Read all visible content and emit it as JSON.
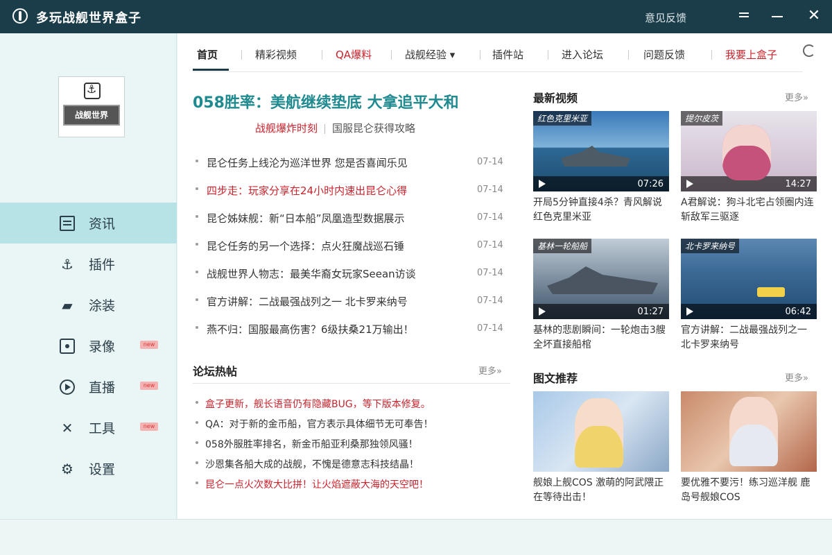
{
  "titlebar": {
    "title": "多玩战舰世界盒子",
    "feedback": "意见反馈",
    "close": "✕"
  },
  "sidebar": {
    "logo_text": "战舰世界",
    "items": [
      {
        "label": "资讯",
        "icon": "news-icon",
        "active": true,
        "new": false
      },
      {
        "label": "插件",
        "icon": "anchor-icon",
        "active": false,
        "new": false
      },
      {
        "label": "涂装",
        "icon": "paint-icon",
        "active": false,
        "new": false
      },
      {
        "label": "录像",
        "icon": "record-icon",
        "active": false,
        "new": true
      },
      {
        "label": "直播",
        "icon": "play-icon",
        "active": false,
        "new": true
      },
      {
        "label": "工具",
        "icon": "tools-icon",
        "active": false,
        "new": true
      },
      {
        "label": "设置",
        "icon": "gear-icon",
        "active": false,
        "new": false
      }
    ],
    "new_tag": "new"
  },
  "tabs": [
    {
      "label": "首页"
    },
    {
      "label": "精彩视频"
    },
    {
      "label": "QA爆料"
    },
    {
      "label": "战舰经验 ▾"
    },
    {
      "label": "插件站"
    },
    {
      "label": "进入论坛"
    },
    {
      "label": "问题反馈"
    },
    {
      "label": "我要上盒子"
    }
  ],
  "headline": {
    "title": "058胜率：美航继续垫底 大拿追平大和",
    "sub_a": "战舰爆炸时刻",
    "sub_b": "国服昆仑获得攻略"
  },
  "news": [
    {
      "title": "昆仑任务上线沦为巡洋世界 您是否喜闻乐见",
      "date": "07-14"
    },
    {
      "title": "四步走：玩家分享在24小时内速出昆仑心得",
      "date": "07-14"
    },
    {
      "title": "昆仑姊妹舰：新“日本船”凤凰造型数据展示",
      "date": "07-14"
    },
    {
      "title": "昆仑任务的另一个选择：点火狂魔战巡石锤",
      "date": "07-14"
    },
    {
      "title": "战舰世界人物志：最美华裔女玩家Seean访谈",
      "date": "07-14"
    },
    {
      "title": "官方讲解：二战最强战列之一 北卡罗来纳号",
      "date": "07-14"
    },
    {
      "title": "燕不归：国服最高伤害？6级扶桑21万输出！",
      "date": "07-14"
    }
  ],
  "forum": {
    "title": "论坛热帖",
    "more": "更多»",
    "items": [
      {
        "title": "盒子更新，舰长语音仍有隐藏BUG，等下版本修复。"
      },
      {
        "title": "QA：对于新的金币船，官方表示具体细节无可奉告！"
      },
      {
        "title": "058外服胜率排名，新金币船亚利桑那独领风骚！"
      },
      {
        "title": "沙恩集各船大成的战舰，不愧是德意志科技结晶！"
      },
      {
        "title": "昆仑一点火次数大比拼！让火焰遮蔽大海的天空吧！"
      }
    ]
  },
  "videos": {
    "title": "最新视频",
    "more": "更多»",
    "items": [
      {
        "thumb_title": "红色克里米亚",
        "duration": "07:26",
        "caption": "开局5分钟直接4杀？青风解说红色克里米亚"
      },
      {
        "thumb_title": "提尔皮茨",
        "duration": "14:27",
        "caption": "A君解说：狗斗北宅占领圈内连斩敌军三驱逐"
      },
      {
        "thumb_title": "基林一轮船船",
        "duration": "01:27",
        "caption": "基林的悲剧瞬间：一轮炮击3艘全坏直接船棺"
      },
      {
        "thumb_title": "北卡罗来纳号",
        "duration": "06:42",
        "caption": "官方讲解：二战最强战列之一 北卡罗来纳号"
      }
    ]
  },
  "images": {
    "title": "图文推荐",
    "more": "更多»",
    "items": [
      {
        "caption": "舰娘上舰COS 激萌的阿武隈正在等待出击！"
      },
      {
        "caption": "要优雅不要污！练习巡洋舰 鹿岛号舰娘COS"
      }
    ]
  },
  "colors": {
    "titlebar": "#1b3d4a",
    "accent": "#1f8a8f",
    "red": "#c8232c",
    "sidebar_active": "#b7e3e6"
  }
}
